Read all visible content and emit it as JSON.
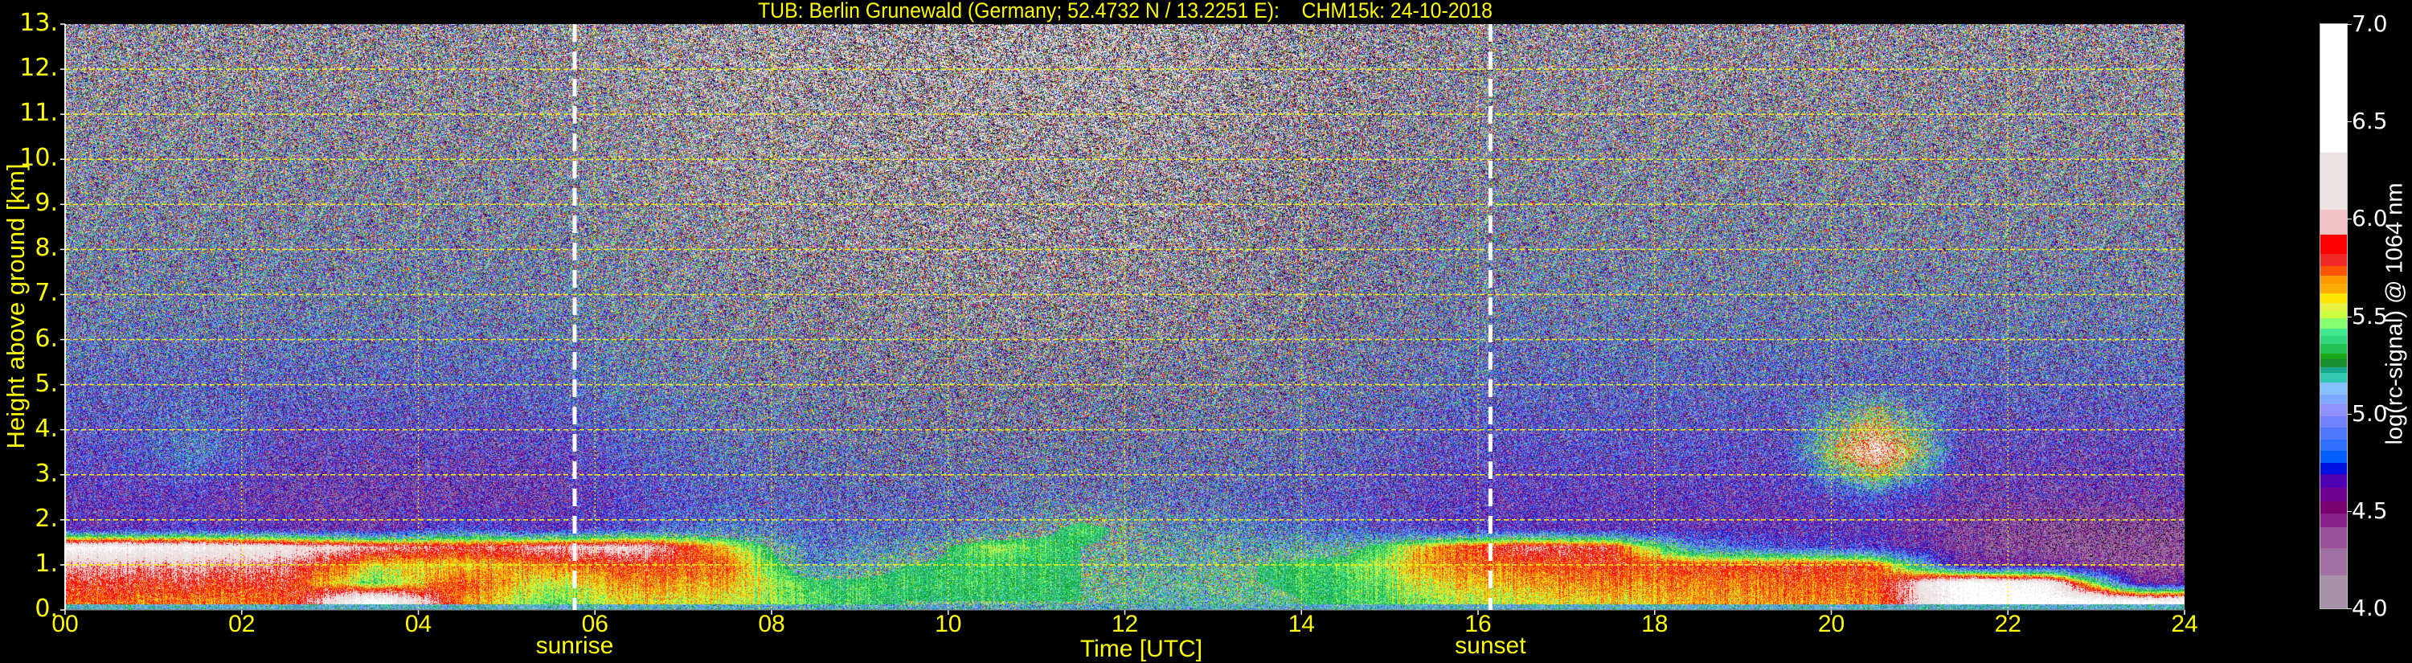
{
  "chart_data": {
    "type": "heatmap",
    "title": "TUB: Berlin Grunewald (Germany; 52.4732 N / 13.2251 E):    CHM15k: 24-10-2018",
    "xlabel": "Time [UTC]",
    "ylabel": "Height above ground [km]",
    "xlim": [
      0,
      24
    ],
    "ylim": [
      0,
      13
    ],
    "x_ticks": [
      "00",
      "02",
      "04",
      "06",
      "08",
      "10",
      "12",
      "14",
      "16",
      "18",
      "20",
      "22",
      "24"
    ],
    "x_tick_values": [
      0,
      2,
      4,
      6,
      8,
      10,
      12,
      14,
      16,
      18,
      20,
      22,
      24
    ],
    "y_ticks": [
      "0.",
      "1.",
      "2.",
      "3.",
      "4.",
      "5.",
      "6.",
      "7.",
      "8.",
      "9.",
      "10.",
      "11.",
      "12.",
      "13."
    ],
    "y_tick_values": [
      0,
      1,
      2,
      3,
      4,
      5,
      6,
      7,
      8,
      9,
      10,
      11,
      12,
      13
    ],
    "grid": true,
    "grid_color": "#ffff00",
    "annotations": [
      {
        "label": "sunrise",
        "x": 5.77,
        "line_color": "#ffffff"
      },
      {
        "label": "sunset",
        "x": 16.14,
        "line_color": "#ffffff"
      }
    ],
    "z_label": "log(rc-signal) @ 1064 nm",
    "times_utc_h": [
      0.5,
      1.5,
      2.5,
      3.5,
      4.5,
      5.5,
      6.5,
      7.5,
      8.5,
      9.5,
      10.5,
      11.5,
      12.5,
      13.5,
      14.5,
      15.5,
      16.5,
      17.5,
      18.5,
      19.5,
      20.5,
      21.5,
      22.5,
      23.5
    ],
    "heights_km": [
      0.2,
      0.6,
      1.0,
      1.4,
      1.8,
      2.5,
      3.5,
      5,
      7,
      9.5,
      12
    ],
    "values_log_signal": [
      [
        5.75,
        5.85,
        6.0,
        6.4,
        4.6,
        4.6,
        4.7,
        4.8,
        5.0,
        5.1,
        5.2
      ],
      [
        5.7,
        5.85,
        6.0,
        6.3,
        4.7,
        4.6,
        5.0,
        4.8,
        5.0,
        5.1,
        5.2
      ],
      [
        5.75,
        5.85,
        5.95,
        6.2,
        4.6,
        4.5,
        4.6,
        4.8,
        5.0,
        5.1,
        5.2
      ],
      [
        6.5,
        5.4,
        5.6,
        6.0,
        4.5,
        4.5,
        4.6,
        4.8,
        5.0,
        5.1,
        5.2
      ],
      [
        5.7,
        5.8,
        5.6,
        5.9,
        4.8,
        4.5,
        4.6,
        4.8,
        5.0,
        5.1,
        5.2
      ],
      [
        5.4,
        5.5,
        5.7,
        6.0,
        4.6,
        4.5,
        4.6,
        4.8,
        5.0,
        5.1,
        5.2
      ],
      [
        5.6,
        5.7,
        5.8,
        6.1,
        4.8,
        4.7,
        4.8,
        5.0,
        5.1,
        5.2,
        5.3
      ],
      [
        5.55,
        5.65,
        5.75,
        5.6,
        5.0,
        4.8,
        4.9,
        5.0,
        5.1,
        5.3,
        5.4
      ],
      [
        5.4,
        5.35,
        5.05,
        4.95,
        4.85,
        4.8,
        4.9,
        5.0,
        5.1,
        5.3,
        5.4
      ],
      [
        5.3,
        5.35,
        5.3,
        5.1,
        4.9,
        4.8,
        4.9,
        5.0,
        5.2,
        5.3,
        5.4
      ],
      [
        5.3,
        5.35,
        5.35,
        5.5,
        5.0,
        4.85,
        4.9,
        5.0,
        5.2,
        5.3,
        5.5
      ],
      [
        5.3,
        5.3,
        5.3,
        5.3,
        5.4,
        4.9,
        4.9,
        5.0,
        5.2,
        5.3,
        5.5
      ],
      [
        5.2,
        5.25,
        5.2,
        5.2,
        5.1,
        4.9,
        4.9,
        5.0,
        5.2,
        5.3,
        5.5
      ],
      [
        5.25,
        5.3,
        5.3,
        5.15,
        5.0,
        4.8,
        4.9,
        5.0,
        5.1,
        5.2,
        5.3
      ],
      [
        5.35,
        5.35,
        5.4,
        5.2,
        4.85,
        4.7,
        4.8,
        4.9,
        5.0,
        5.1,
        5.2
      ],
      [
        5.5,
        5.6,
        5.7,
        5.7,
        4.7,
        4.65,
        4.7,
        4.9,
        5.0,
        5.1,
        5.2
      ],
      [
        5.55,
        5.65,
        5.75,
        5.95,
        4.65,
        4.6,
        4.7,
        4.8,
        5.0,
        5.1,
        5.2
      ],
      [
        5.6,
        5.7,
        5.8,
        5.85,
        4.6,
        4.6,
        4.7,
        4.8,
        5.0,
        5.1,
        5.2
      ],
      [
        5.65,
        5.7,
        5.8,
        5.0,
        4.6,
        4.6,
        4.7,
        4.8,
        5.0,
        5.1,
        5.2
      ],
      [
        5.7,
        5.75,
        5.85,
        4.8,
        4.6,
        4.6,
        4.7,
        4.8,
        5.0,
        5.1,
        5.2
      ],
      [
        5.7,
        5.75,
        5.8,
        4.7,
        4.6,
        4.8,
        6.3,
        4.8,
        5.0,
        5.1,
        5.2
      ],
      [
        6.5,
        6.5,
        4.5,
        4.4,
        4.4,
        4.5,
        4.6,
        4.8,
        5.0,
        5.1,
        5.2
      ],
      [
        6.5,
        6.3,
        4.5,
        4.3,
        4.3,
        4.5,
        4.6,
        4.8,
        5.0,
        5.1,
        5.2
      ],
      [
        6.4,
        4.5,
        4.3,
        4.3,
        4.3,
        4.5,
        4.6,
        4.8,
        5.0,
        5.1,
        5.2
      ]
    ],
    "colorbar": {
      "range": [
        4.0,
        7.0
      ],
      "ticks": [
        "4.0",
        "4.5",
        "5.0",
        "5.5",
        "6.0",
        "6.5",
        "7.0"
      ],
      "tick_values": [
        4.0,
        4.5,
        5.0,
        5.5,
        6.0,
        6.5,
        7.0
      ],
      "under_color": "#000000",
      "boundaries": [
        4.0,
        4.17,
        4.31,
        4.42,
        4.49,
        4.55,
        4.62,
        4.69,
        4.75,
        4.81,
        4.87,
        4.93,
        4.99,
        5.05,
        5.1,
        5.16,
        5.21,
        5.24,
        5.28,
        5.31,
        5.36,
        5.4,
        5.44,
        5.49,
        5.53,
        5.57,
        5.62,
        5.67,
        5.71,
        5.76,
        5.82,
        5.92,
        6.05,
        6.34,
        7.0
      ],
      "colors": [
        "#a890a8",
        "#a070a0",
        "#985098",
        "#882088",
        "#780070",
        "#700090",
        "#5000b0",
        "#0010e0",
        "#0060ff",
        "#3070ff",
        "#5078ff",
        "#7080ff",
        "#9090ff",
        "#80a8ff",
        "#88c0ff",
        "#30c8b0",
        "#18a890",
        "#189030",
        "#18a818",
        "#20c050",
        "#30d880",
        "#40e890",
        "#88ff70",
        "#ccff40",
        "#e6f040",
        "#ffe600",
        "#ffaa00",
        "#ff9900",
        "#ff5500",
        "#f02828",
        "#ff0000",
        "#f0c4c4",
        "#ece4e4",
        "#ffffff"
      ]
    }
  }
}
